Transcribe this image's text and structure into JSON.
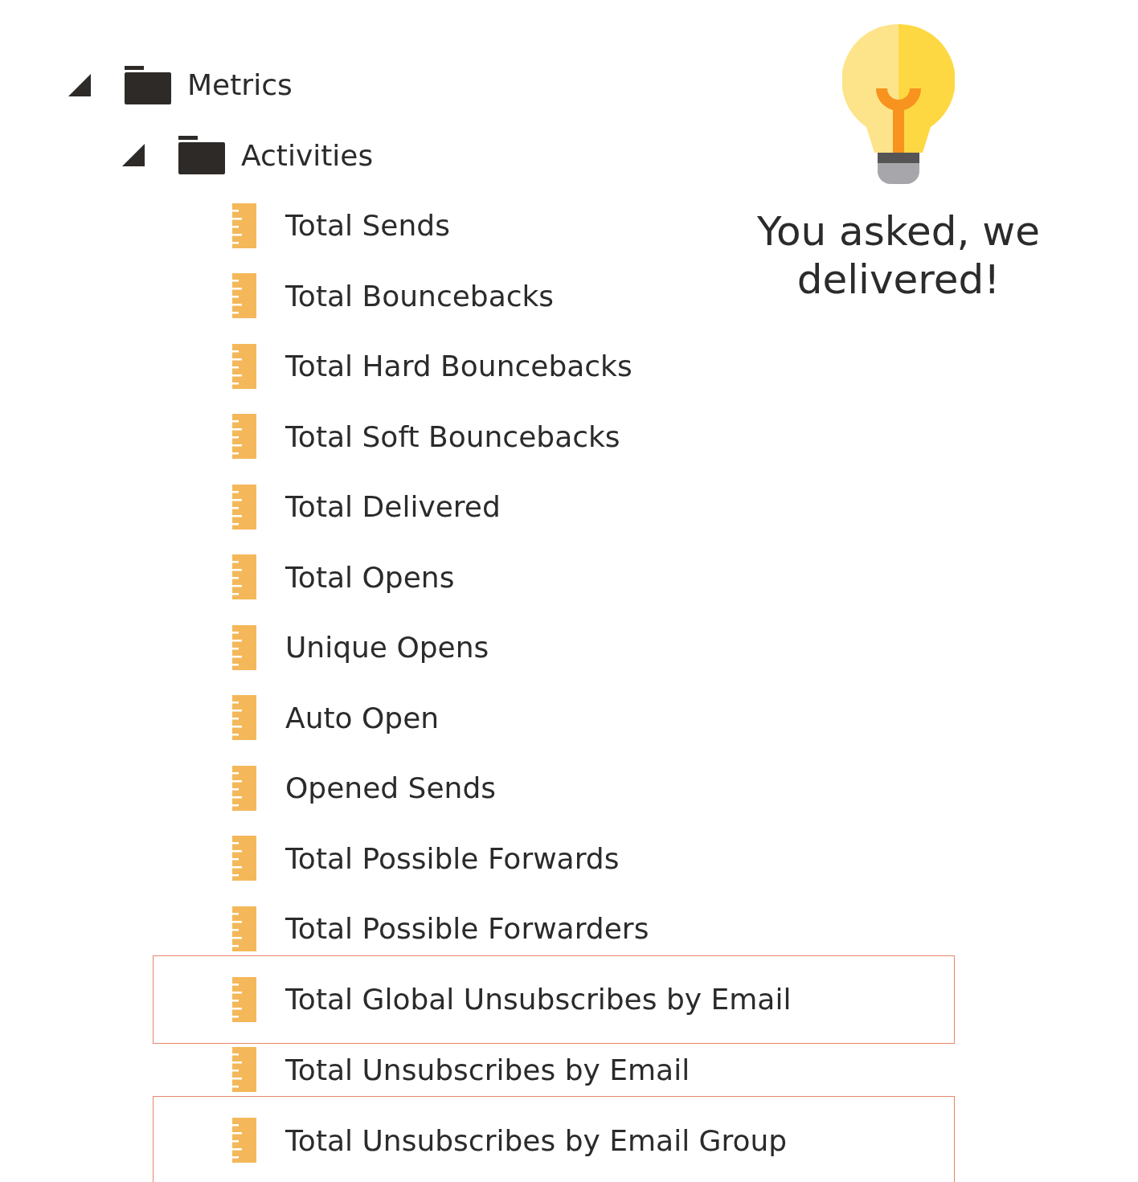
{
  "tree": [
    {
      "label": "Metrics",
      "kind": "folder",
      "expanded": true,
      "children": [
        {
          "label": "Activities",
          "kind": "folder",
          "expanded": true,
          "children": [
            {
              "label": "Total Sends",
              "kind": "metric",
              "highlighted": false
            },
            {
              "label": "Total Bouncebacks",
              "kind": "metric",
              "highlighted": false
            },
            {
              "label": "Total Hard Bouncebacks",
              "kind": "metric",
              "highlighted": false
            },
            {
              "label": "Total Soft Bouncebacks",
              "kind": "metric",
              "highlighted": false
            },
            {
              "label": "Total Delivered",
              "kind": "metric",
              "highlighted": false
            },
            {
              "label": "Total Opens",
              "kind": "metric",
              "highlighted": false
            },
            {
              "label": "Unique Opens",
              "kind": "metric",
              "highlighted": false
            },
            {
              "label": "Auto Open",
              "kind": "metric",
              "highlighted": false
            },
            {
              "label": "Opened Sends",
              "kind": "metric",
              "highlighted": false
            },
            {
              "label": "Total Possible Forwards",
              "kind": "metric",
              "highlighted": false
            },
            {
              "label": "Total Possible Forwarders",
              "kind": "metric",
              "highlighted": false
            },
            {
              "label": "Total Global Unsubscribes by Email",
              "kind": "metric",
              "highlighted": true
            },
            {
              "label": "Total Unsubscribes by Email",
              "kind": "metric",
              "highlighted": false
            },
            {
              "label": "Total Unsubscribes by Email Group",
              "kind": "metric",
              "highlighted": true
            }
          ]
        }
      ]
    }
  ],
  "callout": {
    "text": "You asked, we delivered!"
  }
}
